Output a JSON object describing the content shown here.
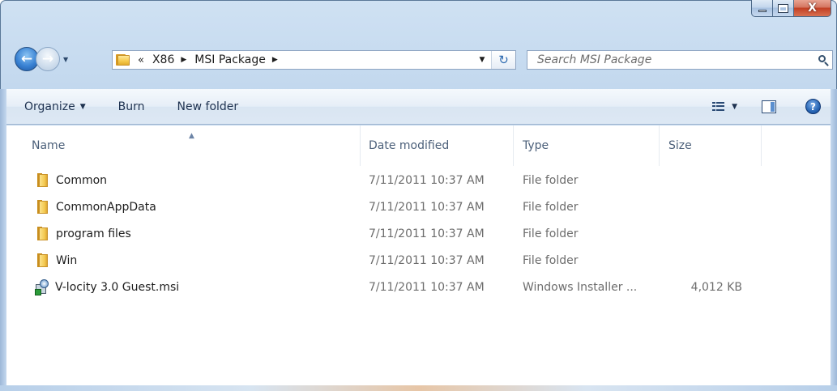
{
  "window": {
    "caption": {
      "minimize": "—",
      "maximize": "□",
      "close": "X"
    }
  },
  "navigation": {
    "back_glyph": "←",
    "forward_glyph": "→",
    "history_glyph": "▼"
  },
  "address_bar": {
    "overflow": "«",
    "crumbs": [
      "X86",
      "MSI Package"
    ],
    "separator": "▶",
    "dropdown_glyph": "▼",
    "refresh_glyph": "↻"
  },
  "search": {
    "placeholder": "Search MSI Package"
  },
  "toolbar": {
    "organize": "Organize",
    "burn": "Burn",
    "new_folder": "New folder",
    "caret": "▼",
    "help": "?"
  },
  "columns": {
    "name": "Name",
    "date": "Date modified",
    "type": "Type",
    "size": "Size",
    "sort_glyph": "▲"
  },
  "files": [
    {
      "name": "Common",
      "date": "7/11/2011 10:37 AM",
      "type": "File folder",
      "size": "",
      "icon": "folder-icon"
    },
    {
      "name": "CommonAppData",
      "date": "7/11/2011 10:37 AM",
      "type": "File folder",
      "size": "",
      "icon": "folder-icon"
    },
    {
      "name": "program files",
      "date": "7/11/2011 10:37 AM",
      "type": "File folder",
      "size": "",
      "icon": "folder-icon"
    },
    {
      "name": "Win",
      "date": "7/11/2011 10:37 AM",
      "type": "File folder",
      "size": "",
      "icon": "folder-icon"
    },
    {
      "name": "V-locity 3.0 Guest.msi",
      "date": "7/11/2011 10:37 AM",
      "type": "Windows Installer ...",
      "size": "4,012 KB",
      "icon": "msi-installer-icon"
    }
  ],
  "colors": {
    "frame": "#b9d1ea",
    "toolbar_text": "#1e3250",
    "header_text": "#4c607a",
    "detail_text": "#6d6d6d"
  }
}
